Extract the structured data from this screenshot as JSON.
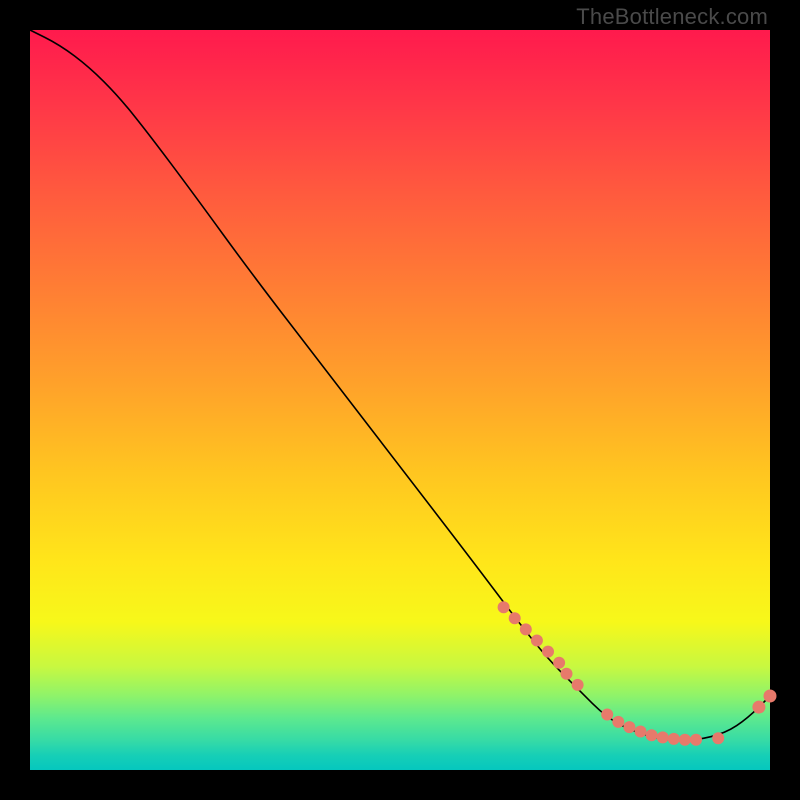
{
  "watermark": "TheBottleneck.com",
  "colors": {
    "dot": "#e77a6b",
    "curve": "#000000"
  },
  "chart_data": {
    "type": "line",
    "title": "",
    "xlabel": "",
    "ylabel": "",
    "xlim": [
      0,
      100
    ],
    "ylim": [
      0,
      100
    ],
    "grid": false,
    "note": "Axes are unlabeled; x ≈ horizontal position (0–100 left→right), y ≈ vertical value (0 bottom → 100 top). Values estimated from pixels.",
    "series": [
      {
        "name": "curve",
        "x": [
          0,
          4,
          8,
          12,
          16,
          22,
          30,
          40,
          50,
          60,
          66,
          70,
          74,
          78,
          82,
          86,
          90,
          94,
          97,
          100
        ],
        "y": [
          100,
          98,
          95,
          91,
          86,
          78,
          67,
          54,
          41,
          28,
          20,
          15,
          11,
          7,
          5,
          4,
          4,
          5,
          7,
          10
        ]
      }
    ],
    "points": {
      "name": "highlighted-dots",
      "note": "Cluster of salmon dots along the lower-right portion of the curve",
      "x": [
        64,
        65.5,
        67,
        68.5,
        70,
        71.5,
        72.5,
        74,
        78,
        79.5,
        81,
        82.5,
        84,
        85.5,
        87,
        88.5,
        90,
        93,
        98.5,
        100
      ],
      "y": [
        22,
        20.5,
        19,
        17.5,
        16,
        14.5,
        13,
        11.5,
        7.5,
        6.5,
        5.8,
        5.2,
        4.7,
        4.4,
        4.2,
        4.1,
        4.1,
        4.3,
        8.5,
        10
      ]
    }
  }
}
